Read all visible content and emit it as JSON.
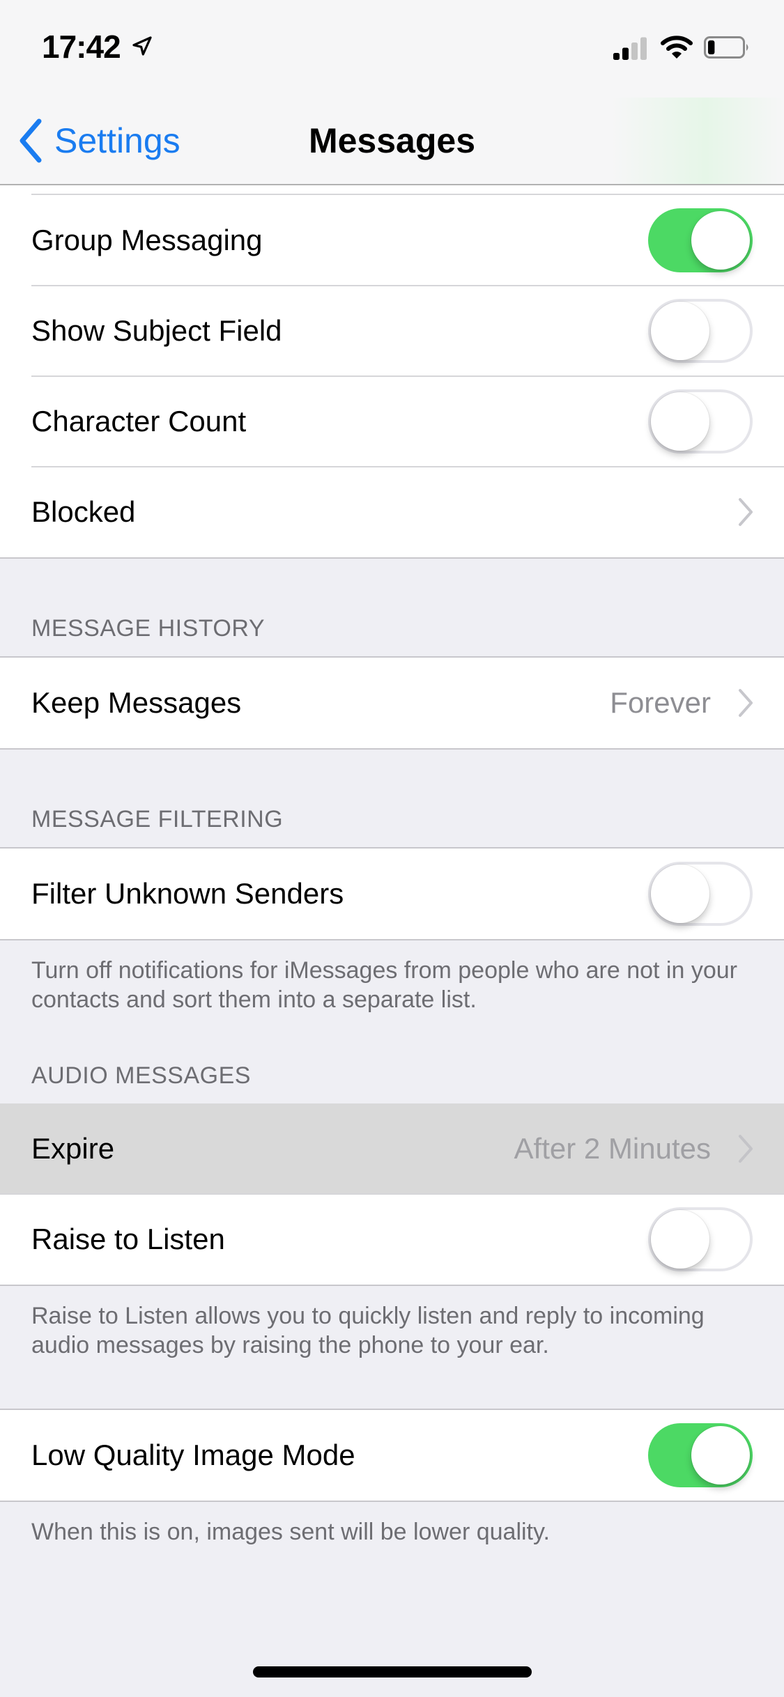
{
  "status_bar": {
    "time": "17:42",
    "location_icon": "location-arrow-icon",
    "signal_bars": 2,
    "signal_bars_total": 4,
    "wifi_icon": "wifi-icon",
    "battery_level_percent": 20
  },
  "nav": {
    "back_label": "Settings",
    "back_icon": "chevron-left-icon",
    "title": "Messages"
  },
  "groups": {
    "general": {
      "rows": [
        {
          "label": "Group Messaging",
          "type": "toggle",
          "on": true
        },
        {
          "label": "Show Subject Field",
          "type": "toggle",
          "on": false
        },
        {
          "label": "Character Count",
          "type": "toggle",
          "on": false
        },
        {
          "label": "Blocked",
          "type": "disclosure"
        }
      ]
    },
    "history": {
      "header": "MESSAGE HISTORY",
      "rows": [
        {
          "label": "Keep Messages",
          "value": "Forever",
          "type": "disclosure"
        }
      ]
    },
    "filtering": {
      "header": "MESSAGE FILTERING",
      "rows": [
        {
          "label": "Filter Unknown Senders",
          "type": "toggle",
          "on": false
        }
      ],
      "footer": "Turn off notifications for iMessages from people who are not in your contacts and sort them into a separate list."
    },
    "audio": {
      "header": "AUDIO MESSAGES",
      "rows": [
        {
          "label": "Expire",
          "value": "After 2 Minutes",
          "type": "disclosure",
          "highlighted": true
        },
        {
          "label": "Raise to Listen",
          "type": "toggle",
          "on": false
        }
      ],
      "footer": "Raise to Listen allows you to quickly listen and reply to incoming audio messages by raising the phone to your ear."
    },
    "image": {
      "rows": [
        {
          "label": "Low Quality Image Mode",
          "type": "toggle",
          "on": true
        }
      ],
      "footer": "When this is on, images sent will be lower quality."
    }
  },
  "colors": {
    "accent": "#1a7cf0",
    "toggle_on": "#4cd964",
    "background": "#efeff4",
    "secondary_text": "#6d6d72",
    "highlight_row": "#d9d9d9"
  }
}
